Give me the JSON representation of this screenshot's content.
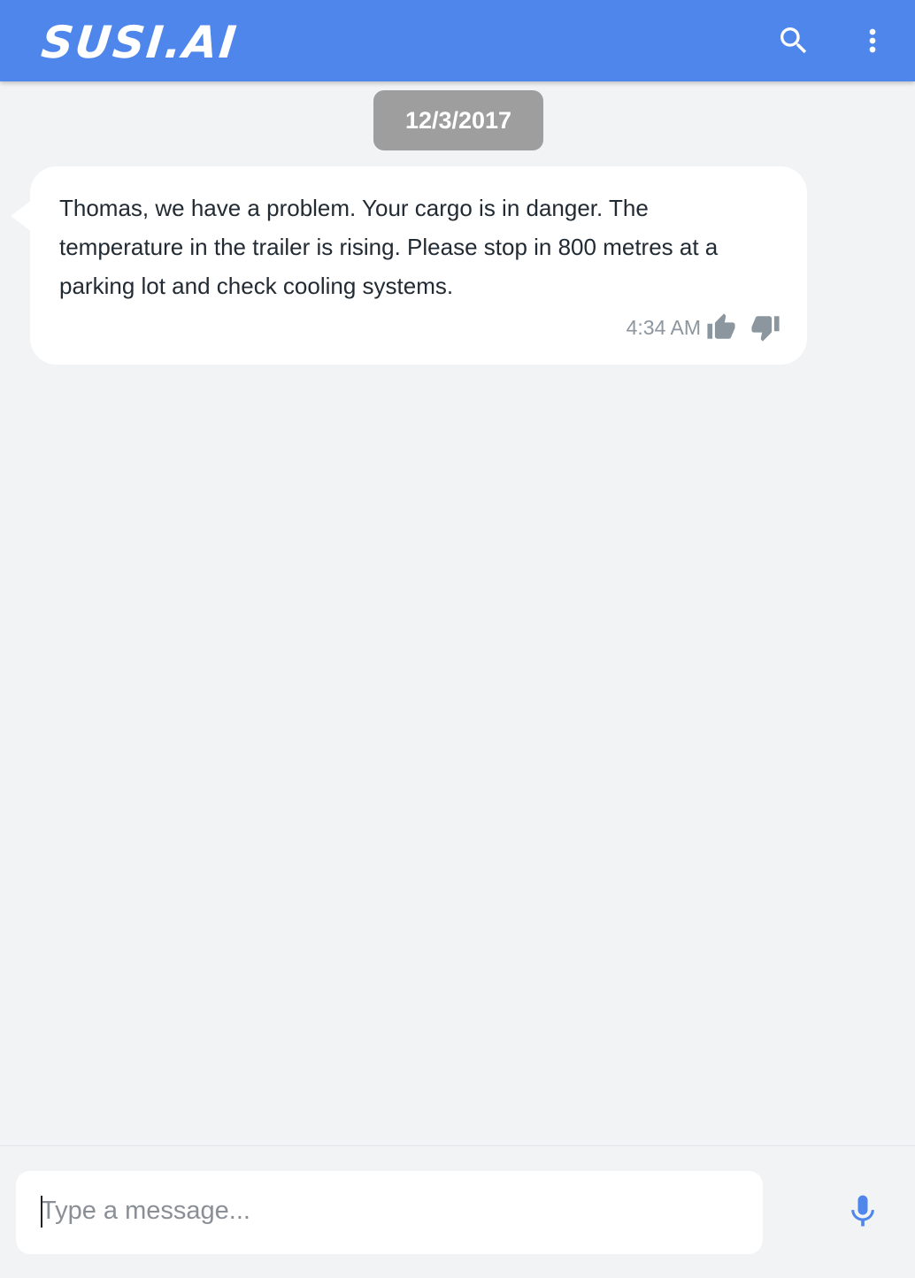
{
  "header": {
    "logo_text": "SUSI.AI",
    "background_color": "#4f86ec",
    "search_icon": "search-icon",
    "menu_icon": "more-vert-icon"
  },
  "chat": {
    "date_label": "12/3/2017",
    "messages": [
      {
        "text": "Thomas, we have a problem. Your cargo is in danger. The temperature in the trailer is rising. Please stop in 800 metres at a parking lot and check cooling systems.",
        "time": "4:34 AM",
        "thumbs_up_icon": "thumbs-up-icon",
        "thumbs_down_icon": "thumbs-down-icon"
      }
    ]
  },
  "composer": {
    "value": "",
    "placeholder": "Type a message...",
    "mic_icon": "mic-icon",
    "mic_color": "#4f86ec"
  }
}
